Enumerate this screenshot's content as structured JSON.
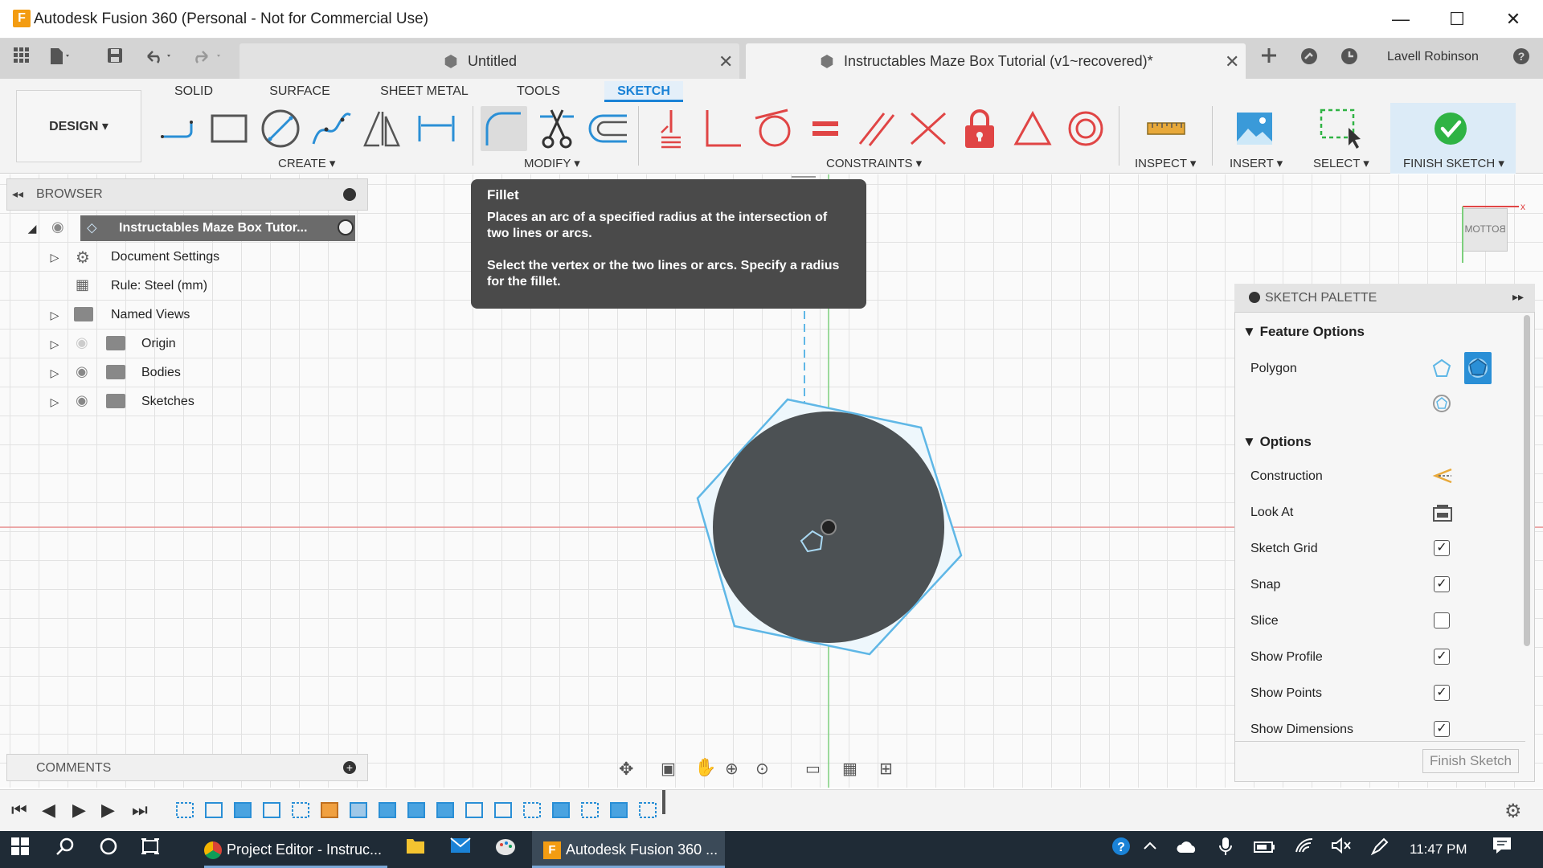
{
  "window": {
    "title": "Autodesk Fusion 360 (Personal - Not for Commercial Use)",
    "logo_letter": "F",
    "minimize": "—",
    "maximize": "☐",
    "close": "✕"
  },
  "tabs": [
    {
      "label": "Untitled",
      "close": "✕"
    },
    {
      "label": "Instructables Maze Box Tutorial (v1~recovered)*",
      "close": "✕"
    }
  ],
  "user": {
    "name": "Lavell Robinson"
  },
  "toolbar": {
    "design": "DESIGN ▾",
    "workspace_tabs": [
      "SOLID",
      "SURFACE",
      "SHEET METAL",
      "TOOLS",
      "SKETCH"
    ],
    "groups": {
      "create": "CREATE ▾",
      "modify": "MODIFY ▾",
      "constraints": "CONSTRAINTS ▾",
      "inspect": "INSPECT ▾",
      "insert": "INSERT ▾",
      "select": "SELECT ▾",
      "finish": "FINISH SKETCH ▾"
    }
  },
  "browser": {
    "title": "BROWSER",
    "root": "Instructables Maze Box Tutor...",
    "items": [
      "Document Settings",
      "Rule: Steel (mm)",
      "Named Views",
      "Origin",
      "Bodies",
      "Sketches"
    ]
  },
  "tooltip": {
    "title": "Fillet",
    "line1": "Places an arc of a specified radius at the intersection of two lines or arcs.",
    "line2": "Select the vertex or the two lines or arcs. Specify a radius for the fillet."
  },
  "viewcube": {
    "face": "BOTTOM"
  },
  "palette": {
    "title": "SKETCH PALETTE",
    "feature_options": "Feature Options",
    "polygon": "Polygon",
    "options": "Options",
    "rows": [
      {
        "label": "Construction",
        "type": "icon"
      },
      {
        "label": "Look At",
        "type": "icon"
      },
      {
        "label": "Sketch Grid",
        "type": "check",
        "checked": "✓"
      },
      {
        "label": "Snap",
        "type": "check",
        "checked": "✓"
      },
      {
        "label": "Slice",
        "type": "check",
        "checked": ""
      },
      {
        "label": "Show Profile",
        "type": "check",
        "checked": "✓"
      },
      {
        "label": "Show Points",
        "type": "check",
        "checked": "✓"
      },
      {
        "label": "Show Dimensions",
        "type": "check",
        "checked": "✓"
      }
    ],
    "finish_button": "Finish Sketch"
  },
  "comments": {
    "title": "COMMENTS"
  },
  "taskbar": {
    "chrome_app": "Project Editor - Instruc...",
    "fusion_app": "Autodesk Fusion 360 ...",
    "time": "11:47 PM"
  },
  "colors": {
    "accent": "#1a82d6",
    "sketch_line": "#5fb7e6",
    "profile_fill": "#4c5154",
    "finish_green": "#2fb344",
    "constraint_red": "#e04545",
    "x_axis": "#e88c8c",
    "y_axis": "#7ccf7c"
  }
}
